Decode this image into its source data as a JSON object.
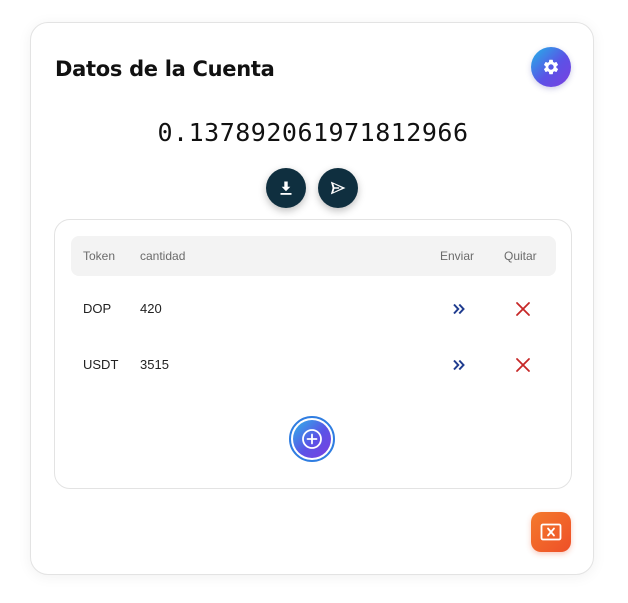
{
  "header": {
    "title": "Datos de la Cuenta",
    "settings_icon": "gear-icon"
  },
  "balance": {
    "value": "0.137892061971812966"
  },
  "actions": {
    "receive_icon": "download-icon",
    "send_icon": "send-icon"
  },
  "token_table": {
    "columns": {
      "token": "Token",
      "cantidad": "cantidad",
      "enviar": "Enviar",
      "quitar": "Quitar"
    },
    "rows": [
      {
        "token": "DOP",
        "cantidad": "420"
      },
      {
        "token": "USDT",
        "cantidad": "3515"
      }
    ],
    "row_send_icon": "double-chevron-right-icon",
    "row_remove_icon": "close-icon",
    "add_icon": "plus-circle-icon"
  },
  "footer": {
    "close_icon": "close-window-icon"
  },
  "colors": {
    "accent_gradient_start": "#21b6e8",
    "accent_gradient_end": "#7b3fe0",
    "dark_button": "#0f2f3f",
    "send_icon_color": "#1f3c8f",
    "remove_icon_color": "#c62828",
    "close_button": "#ee5a28"
  }
}
